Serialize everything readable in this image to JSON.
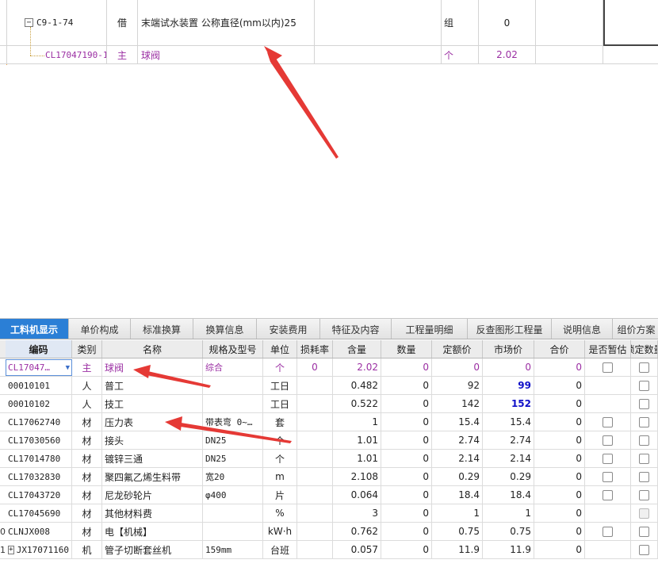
{
  "top_grid": {
    "row1": {
      "code": "C9-1-74",
      "type": "借",
      "name": "末端试水装置 公称直径(mm以内)25",
      "unit": "组",
      "qty": "0",
      "expander": "−"
    },
    "row2": {
      "code": "CL17047190-1",
      "type": "主",
      "name": "球阀",
      "unit": "个",
      "qty": "2.02"
    }
  },
  "tabs": [
    {
      "label": "工料机显示",
      "active": true
    },
    {
      "label": "单价构成"
    },
    {
      "label": "标准换算"
    },
    {
      "label": "换算信息"
    },
    {
      "label": "安装费用"
    },
    {
      "label": "特征及内容"
    },
    {
      "label": "工程量明细"
    },
    {
      "label": "反查图形工程量"
    },
    {
      "label": "说明信息"
    },
    {
      "label": "组价方案"
    }
  ],
  "columns": [
    "编码",
    "类别",
    "名称",
    "规格及型号",
    "单位",
    "损耗率",
    "含量",
    "数量",
    "定额价",
    "市场价",
    "合价",
    "是否暂估",
    "锁定数量"
  ],
  "rows": [
    {
      "code": "CL17047…",
      "type": "主",
      "name": "球阀",
      "spec": "综合",
      "unit": "个",
      "loss": "0",
      "content": "2.02",
      "qty": "0",
      "quota": "0",
      "market": "0",
      "total": "0",
      "estimate": true,
      "purple": true,
      "selected": true
    },
    {
      "code": "00010101",
      "type": "人",
      "name": "普工",
      "spec": "",
      "unit": "工日",
      "loss": "",
      "content": "0.482",
      "qty": "0",
      "quota": "92",
      "market": "99",
      "total": "0",
      "estimate": false,
      "market_blue": true
    },
    {
      "code": "00010102",
      "type": "人",
      "name": "技工",
      "spec": "",
      "unit": "工日",
      "loss": "",
      "content": "0.522",
      "qty": "0",
      "quota": "142",
      "market": "152",
      "total": "0",
      "estimate": false,
      "market_blue": true
    },
    {
      "code": "CL17062740",
      "type": "材",
      "name": "压力表",
      "spec": "带表弯 0~…",
      "unit": "套",
      "loss": "",
      "content": "1",
      "qty": "0",
      "quota": "15.4",
      "market": "15.4",
      "total": "0",
      "estimate": true
    },
    {
      "code": "CL17030560",
      "type": "材",
      "name": "接头",
      "spec": "DN25",
      "unit": "个",
      "loss": "",
      "content": "1.01",
      "qty": "0",
      "quota": "2.74",
      "market": "2.74",
      "total": "0",
      "estimate": true
    },
    {
      "code": "CL17014780",
      "type": "材",
      "name": "镀锌三通",
      "spec": "DN25",
      "unit": "个",
      "loss": "",
      "content": "1.01",
      "qty": "0",
      "quota": "2.14",
      "market": "2.14",
      "total": "0",
      "estimate": true
    },
    {
      "code": "CL17032830",
      "type": "材",
      "name": "聚四氟乙烯生料带",
      "spec": "宽20",
      "unit": "m",
      "loss": "",
      "content": "2.108",
      "qty": "0",
      "quota": "0.29",
      "market": "0.29",
      "total": "0",
      "estimate": true
    },
    {
      "code": "CL17043720",
      "type": "材",
      "name": "尼龙砂轮片",
      "spec": "φ400",
      "unit": "片",
      "loss": "",
      "content": "0.064",
      "qty": "0",
      "quota": "18.4",
      "market": "18.4",
      "total": "0",
      "estimate": true
    },
    {
      "code": "CL17045690",
      "type": "材",
      "name": "其他材料费",
      "spec": "",
      "unit": "%",
      "loss": "",
      "content": "3",
      "qty": "0",
      "quota": "1",
      "market": "1",
      "total": "0",
      "estimate": false,
      "lock_dim": true
    },
    {
      "code": "CLNJX008",
      "type": "材",
      "name": "电【机械】",
      "spec": "",
      "unit": "kW·h",
      "loss": "",
      "content": "0.762",
      "qty": "0",
      "quota": "0.75",
      "market": "0.75",
      "total": "0",
      "estimate": true,
      "rowtag": "0"
    },
    {
      "code": "JX17071160",
      "type": "机",
      "name": "管子切断套丝机",
      "spec": "159mm",
      "unit": "台班",
      "loss": "",
      "content": "0.057",
      "qty": "0",
      "quota": "11.9",
      "market": "11.9",
      "total": "0",
      "estimate": false,
      "rowtag": "1",
      "expander": "+"
    }
  ]
}
